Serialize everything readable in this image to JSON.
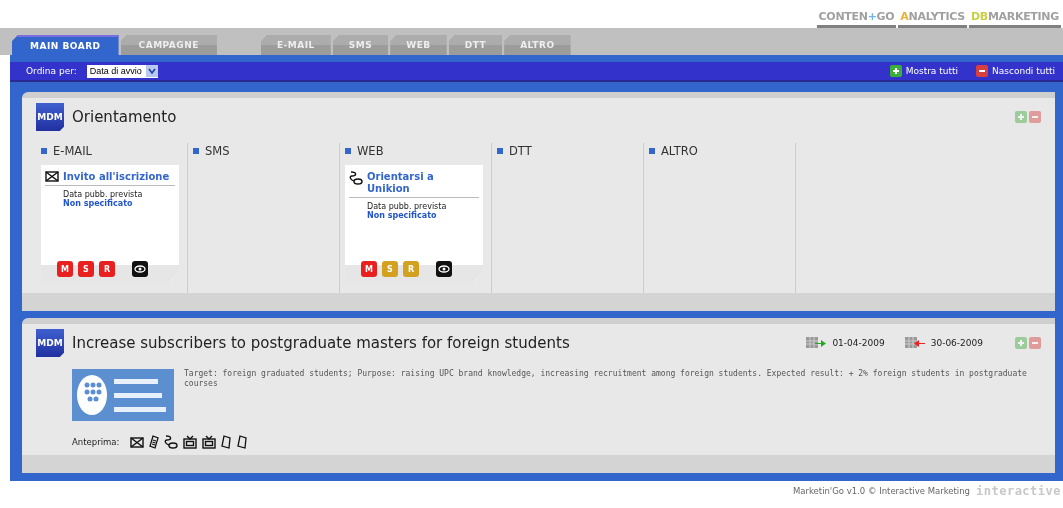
{
  "brands": [
    {
      "parts": [
        {
          "text": "CONTEN",
          "color": "#a0a0a0"
        },
        {
          "text": "+",
          "color": "#6fb3e8"
        },
        {
          "text": "GO",
          "color": "#a0a0a0"
        }
      ]
    },
    {
      "parts": [
        {
          "text": "A",
          "color": "#f0b030"
        },
        {
          "text": "NALYTICS",
          "color": "#a0a0a0"
        }
      ]
    },
    {
      "parts": [
        {
          "text": "DB",
          "color": "#c8d040"
        },
        {
          "text": "MARKETING",
          "color": "#a0a0a0"
        }
      ]
    }
  ],
  "tabs": [
    {
      "label": "MAIN BOARD",
      "selected": true
    },
    {
      "label": "CAMPAGNE",
      "selected": false
    }
  ],
  "channel_tabs": [
    {
      "label": "E-MAIL",
      "selected": false
    },
    {
      "label": "SMS",
      "selected": false
    },
    {
      "label": "WEB",
      "selected": false
    },
    {
      "label": "DTT",
      "selected": false
    },
    {
      "label": "ALTRO",
      "selected": false
    }
  ],
  "toolbar": {
    "sort_label": "Ordina per:",
    "sort_value": "Data di avvio",
    "show_all": "Mostra tutti",
    "hide_all": "Nascondi tutti"
  },
  "campaigns": [
    {
      "badge": "MDM",
      "title": "Orientamento",
      "columns": [
        {
          "label": "E-MAIL",
          "cards": [
            {
              "kind": "email",
              "title": "Invito all'iscrizione",
              "date_label": "Data pubb. prevista",
              "date_value": "Non specificato",
              "markers": [
                {
                  "label": "M",
                  "color": "#e82020"
                },
                {
                  "label": "S",
                  "color": "#e82020"
                },
                {
                  "label": "R",
                  "color": "#e82020"
                }
              ]
            }
          ]
        },
        {
          "label": "SMS"
        },
        {
          "label": "WEB",
          "cards": [
            {
              "kind": "web",
              "title": "Orientarsi a Unikion",
              "date_label": "Data pubb. prevista",
              "date_value": "Non specificato",
              "markers": [
                {
                  "label": "M",
                  "color": "#e82020"
                },
                {
                  "label": "S",
                  "color": "#d4a020"
                },
                {
                  "label": "R",
                  "color": "#d4a020"
                }
              ]
            }
          ]
        },
        {
          "label": "DTT"
        },
        {
          "label": "ALTRO"
        }
      ]
    },
    {
      "badge": "MDM",
      "title": "Increase subscribers to postgraduate masters for foreign students",
      "start_date": "01-04-2009",
      "end_date": "30-06-2009",
      "description": "Target: foreign graduated students; Purpose: raising UPC brand knowledge, increasing recruitment among foreign students. Expected result: + 2% foreign students in postgraduate courses",
      "preview_label": "Anteprima:"
    }
  ],
  "footer": {
    "text": "Marketin'Go v1.0 © Interactive Marketing",
    "logo": "interactive"
  }
}
